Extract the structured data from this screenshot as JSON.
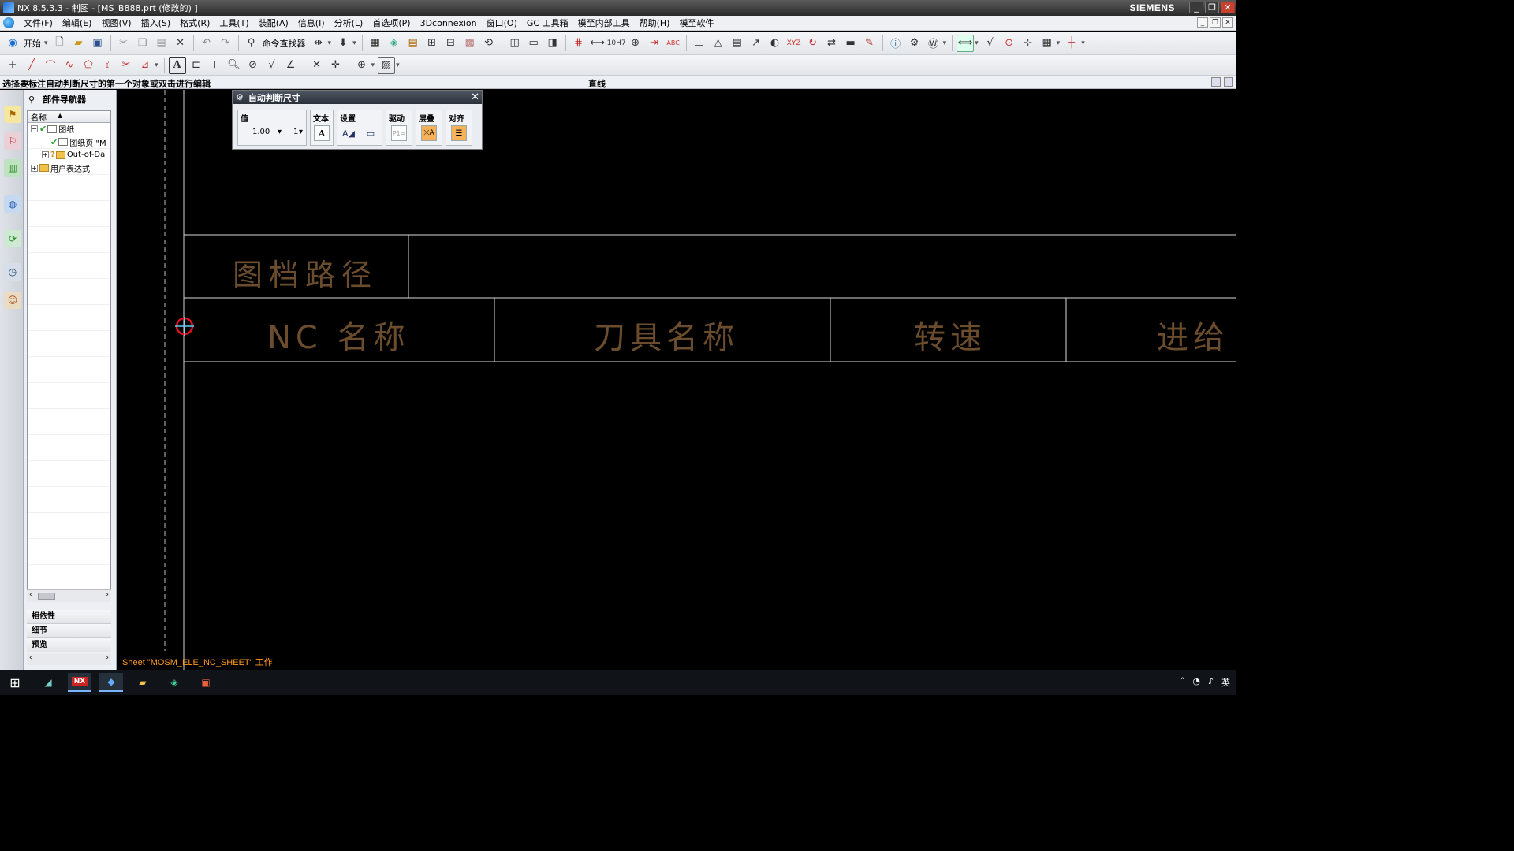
{
  "window": {
    "title": "NX 8.5.3.3 - 制图 - [MS_B888.prt  (修改的)  ]",
    "brand": "SIEMENS",
    "controls": [
      "_",
      "❐",
      "✕"
    ]
  },
  "menu": {
    "items": [
      "文件(F)",
      "编辑(E)",
      "视图(V)",
      "插入(S)",
      "格式(R)",
      "工具(T)",
      "装配(A)",
      "信息(I)",
      "分析(L)",
      "首选项(P)",
      "3Dconnexion",
      "窗口(O)",
      "GC 工具箱",
      "模至内部工具",
      "帮助(H)",
      "模至软件"
    ]
  },
  "toolbar1": {
    "start_label": "开始",
    "command_finder_label": "命令查找器",
    "icons": [
      "new-icon",
      "open-icon",
      "save-icon",
      "cut-icon",
      "copy-icon",
      "paste-icon",
      "delete-icon",
      "undo-icon",
      "redo-icon"
    ],
    "tolerance_label": "10H7",
    "abc_label": "ABC",
    "xyz_label": "XYZ"
  },
  "cueline": {
    "prompt": "选择要标注自动判断尺寸的第一个对象或双击进行编辑",
    "status": "直线"
  },
  "navigator": {
    "title": "部件导航器",
    "column_header": "名称",
    "nodes": [
      {
        "label": "图纸",
        "depth": 0,
        "expand": "−",
        "check": true,
        "icon": "sheet"
      },
      {
        "label": "图纸页 \"M",
        "depth": 1,
        "expand": "",
        "check": true,
        "icon": "sheet"
      },
      {
        "label": "Out-of-Da",
        "depth": 1,
        "expand": "+",
        "check": false,
        "question": true,
        "icon": "folder"
      },
      {
        "label": "用户表达式",
        "depth": 0,
        "expand": "+",
        "check": false,
        "icon": "folder"
      }
    ],
    "panels": [
      "相依性",
      "细节",
      "预览"
    ]
  },
  "dialog": {
    "title": "自动判断尺寸",
    "groups": {
      "value_label": "值",
      "value": "1.00",
      "decimal_places": "1",
      "text_label": "文本",
      "settings_label": "设置",
      "drive_label": "驱动",
      "stack_label": "层叠",
      "align_label": "对齐"
    }
  },
  "drawing": {
    "row1_label": "图档路径",
    "headers": [
      "NC 名称",
      "刀具名称",
      "转速",
      "进给"
    ],
    "sheet_status": "Sheet \"MOSM_ELE_NC_SHEET\" 工作",
    "text_color": "#6b4d2e",
    "line_color": "#d8d8d8"
  },
  "taskbar": {
    "apps": [
      "windows-start-icon",
      "media-player-icon",
      "nx-app-icon",
      "nx-launcher-icon",
      "file-explorer-icon",
      "network-app-icon",
      "powerpoint-icon"
    ],
    "nx_label": "NX",
    "ime_label": "英"
  }
}
